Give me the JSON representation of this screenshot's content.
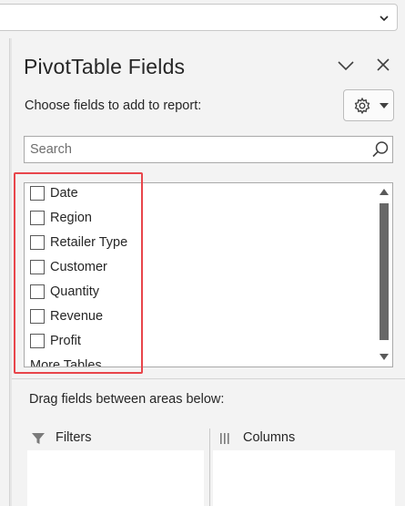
{
  "pane": {
    "title": "PivotTable Fields",
    "choose_label": "Choose fields to add to report:",
    "search_placeholder": "Search",
    "drag_label": "Drag fields between areas below:"
  },
  "fields": [
    {
      "label": "Date",
      "checked": false
    },
    {
      "label": "Region",
      "checked": false
    },
    {
      "label": "Retailer Type",
      "checked": false
    },
    {
      "label": "Customer",
      "checked": false
    },
    {
      "label": "Quantity",
      "checked": false
    },
    {
      "label": "Revenue",
      "checked": false
    },
    {
      "label": "Profit",
      "checked": false
    },
    {
      "label": "More Tables...",
      "checked": false
    }
  ],
  "areas": {
    "filters_label": "Filters",
    "columns_label": "Columns"
  },
  "icons": {
    "collapse": "chevron-down-icon",
    "close": "close-icon",
    "settings": "gear-icon",
    "search": "search-icon",
    "filters": "filter-icon",
    "columns": "columns-icon"
  },
  "colors": {
    "highlight": "#e8454b",
    "pane_bg": "#f3f3f3"
  }
}
